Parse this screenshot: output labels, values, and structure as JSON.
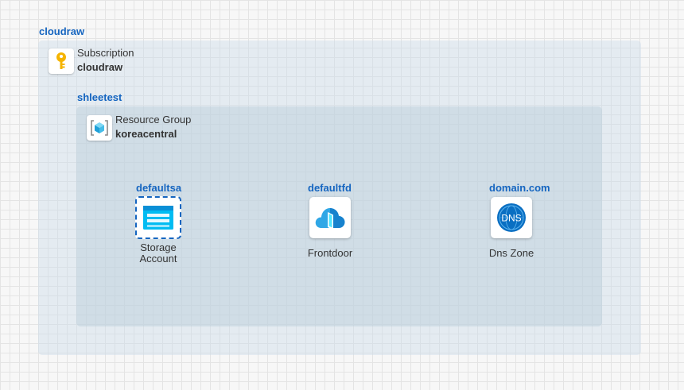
{
  "root": {
    "label": "cloudraw"
  },
  "subscription": {
    "type_label": "Subscription",
    "name": "cloudraw",
    "icon": "key-icon"
  },
  "resource_group": {
    "outer_label": "shleetest",
    "type_label": "Resource Group",
    "name": "koreacentral",
    "icon": "resource-group-icon"
  },
  "nodes": [
    {
      "name": "defaultsa",
      "caption_line1": "Storage",
      "caption_line2": "Account",
      "icon": "storage-account-icon",
      "selected": true
    },
    {
      "name": "defaultfd",
      "caption": "Frontdoor",
      "icon": "frontdoor-icon"
    },
    {
      "name": "domain.com",
      "caption": "Dns Zone",
      "icon": "dns-zone-icon",
      "icon_text": "DNS"
    }
  ],
  "colors": {
    "accent": "#1565c0",
    "storage": "#00bcf2",
    "dns": "#0a6fc2"
  }
}
